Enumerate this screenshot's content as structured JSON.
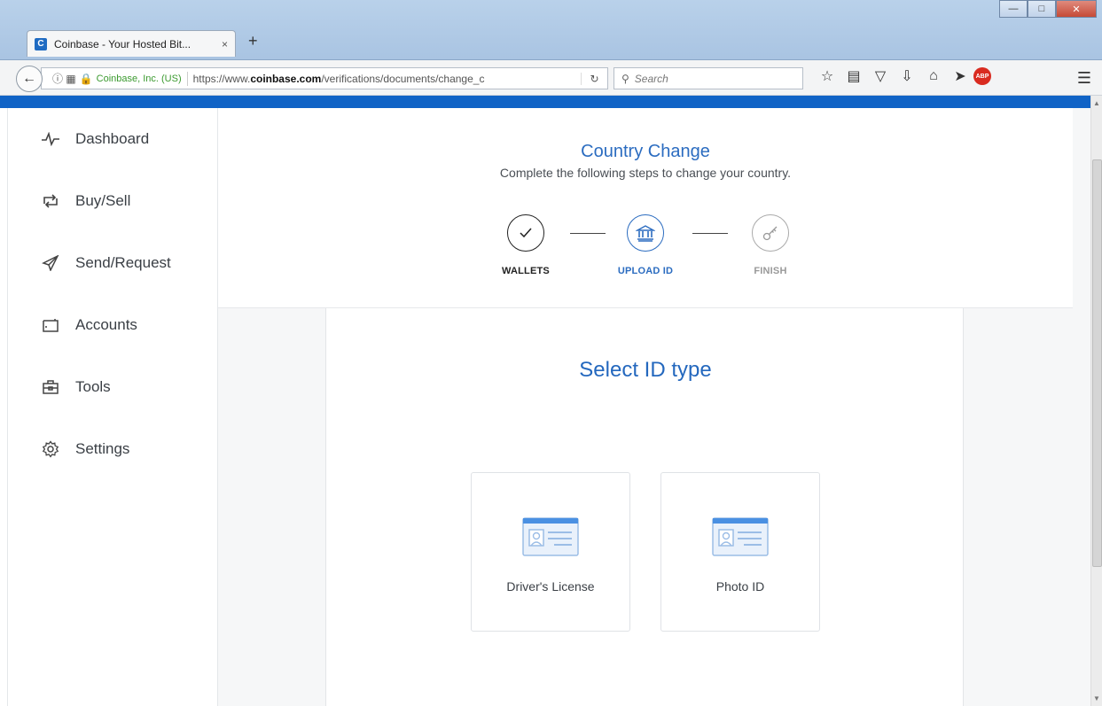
{
  "browser": {
    "tab_title": "Coinbase - Your Hosted Bit...",
    "tab_favicon": "C",
    "tab_close": "×",
    "new_tab": "+",
    "site_identity": "Coinbase, Inc. (US)",
    "url_prefix": "https://www.",
    "url_domain": "coinbase.com",
    "url_path": "/verifications/documents/change_c",
    "search_placeholder": "Search",
    "abp_label": "ABP"
  },
  "sidebar": {
    "items": [
      {
        "label": "Dashboard",
        "icon": "pulse-icon"
      },
      {
        "label": "Buy/Sell",
        "icon": "exchange-icon"
      },
      {
        "label": "Send/Request",
        "icon": "paper-plane-icon"
      },
      {
        "label": "Accounts",
        "icon": "wallet-icon"
      },
      {
        "label": "Tools",
        "icon": "toolbox-icon"
      },
      {
        "label": "Settings",
        "icon": "gear-icon"
      }
    ]
  },
  "header": {
    "title": "Country Change",
    "subtitle": "Complete the following steps to change your country."
  },
  "steps": [
    {
      "label": "WALLETS",
      "state": "done",
      "icon": "check-icon"
    },
    {
      "label": "UPLOAD ID",
      "state": "active",
      "icon": "bank-icon"
    },
    {
      "label": "FINISH",
      "state": "todo",
      "icon": "key-icon"
    }
  ],
  "card": {
    "title": "Select ID type",
    "options": [
      {
        "label": "Driver's License",
        "icon": "id-card-icon"
      },
      {
        "label": "Photo ID",
        "icon": "id-card-icon"
      }
    ]
  },
  "colors": {
    "accent": "#2b6cc0",
    "topbar": "#1063c6"
  }
}
